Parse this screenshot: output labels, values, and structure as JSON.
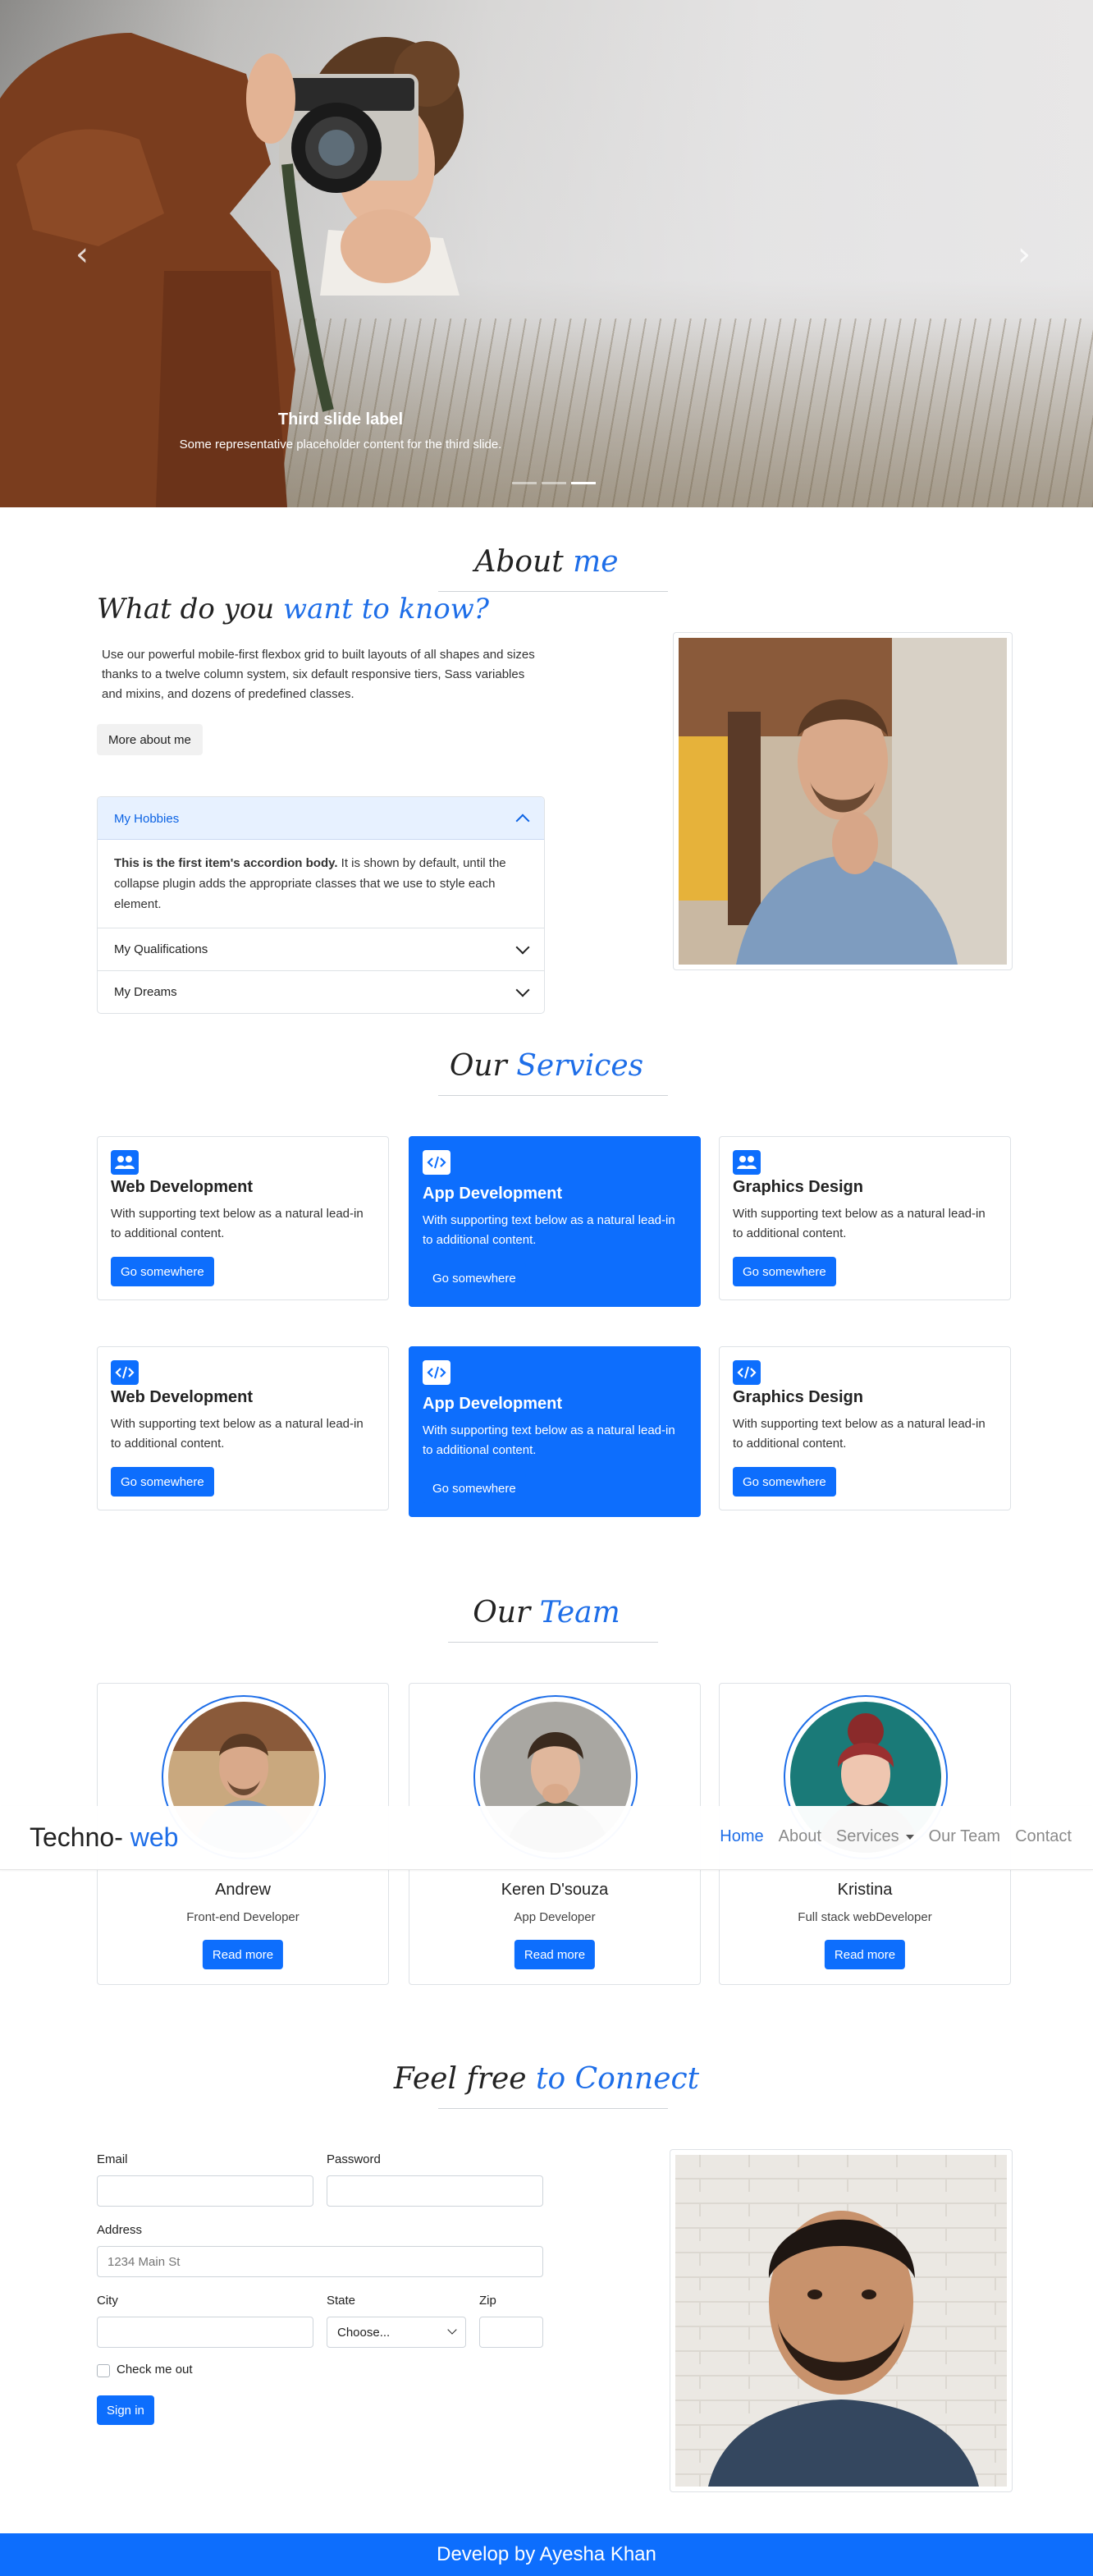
{
  "hero": {
    "caption_title": "Third slide label",
    "caption_text": "Some representative placeholder content for the third slide.",
    "prev_icon": "chevron-left-icon",
    "next_icon": "chevron-right-icon",
    "slides_total": 3,
    "active_slide": 3
  },
  "about": {
    "title_plain": "About ",
    "title_hl": "me",
    "heading_plain": "What do you ",
    "heading_hl": "want to know?",
    "text": "Use our powerful mobile-first flexbox grid to built layouts of all shapes and sizes thanks to a twelve column system, six default responsive tiers, Sass variables and mixins, and dozens of predefined classes.",
    "button": "More about me",
    "accordion": [
      {
        "title": "My Hobbies",
        "open": true,
        "body_bold": "This is the first item's accordion body.",
        "body": " It is shown by default, until the collapse plugin adds the appropriate classes that we use to style each element."
      },
      {
        "title": "My Qualifications",
        "open": false
      },
      {
        "title": "My Dreams",
        "open": false
      }
    ]
  },
  "services": {
    "title_plain": "Our ",
    "title_hl": "Services",
    "cards": [
      {
        "title": "Web Development",
        "text": "With supporting text below as a natural lead-in to additional content.",
        "button": "Go somewhere",
        "icon": "users-icon",
        "highlight": false
      },
      {
        "title": "App Development",
        "text": "With supporting text below as a natural lead-in to additional content.",
        "button": "Go somewhere",
        "icon": "code-icon",
        "highlight": true
      },
      {
        "title": "Graphics Design",
        "text": "With supporting text below as a natural lead-in to additional content.",
        "button": "Go somewhere",
        "icon": "users-icon",
        "highlight": false
      },
      {
        "title": "Web Development",
        "text": "With supporting text below as a natural lead-in to additional content.",
        "button": "Go somewhere",
        "icon": "code-icon",
        "highlight": false
      },
      {
        "title": "App Development",
        "text": "With supporting text below as a natural lead-in to additional content.",
        "button": "Go somewhere",
        "icon": "code-icon",
        "highlight": true
      },
      {
        "title": "Graphics Design",
        "text": "With supporting text below as a natural lead-in to additional content.",
        "button": "Go somewhere",
        "icon": "code-icon",
        "highlight": false
      }
    ]
  },
  "team": {
    "title_plain": "Our ",
    "title_hl": "Team",
    "members": [
      {
        "name": "Andrew",
        "role": "Front-end Developer",
        "button": "Read more"
      },
      {
        "name": "Keren D'souza",
        "role": "App Developer",
        "button": "Read more"
      },
      {
        "name": "Kristina",
        "role": "Full stack webDeveloper",
        "button": "Read more"
      }
    ]
  },
  "navbar": {
    "brand_plain": "Techno- ",
    "brand_hl": "web",
    "items": [
      "Home",
      "About",
      "Services",
      "Our Team",
      "Contact"
    ],
    "active": "Home"
  },
  "contact": {
    "title_plain": "Feel free ",
    "title_hl": "to Connect",
    "email_label": "Email",
    "password_label": "Password",
    "address_label": "Address",
    "address_placeholder": "1234 Main St",
    "city_label": "City",
    "state_label": "State",
    "state_value": "Choose...",
    "zip_label": "Zip",
    "checkbox_label": "Check me out",
    "submit": "Sign in"
  },
  "footer": {
    "text": "Develop by Ayesha Khan"
  },
  "colors": {
    "primary": "#0d6efd",
    "accent_text": "#1e6ee8",
    "accordion_open_bg": "#e7f1ff"
  }
}
